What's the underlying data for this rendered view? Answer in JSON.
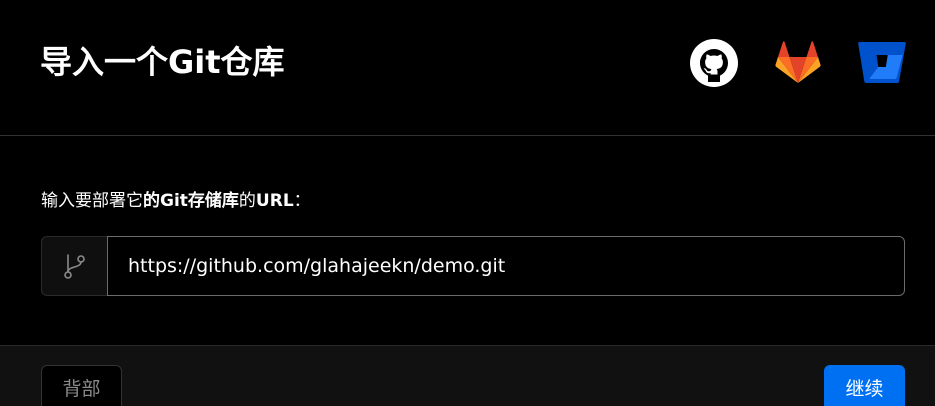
{
  "header": {
    "title": "导入一个Git仓库",
    "providers": [
      {
        "name": "GitHub",
        "icon": "github-icon",
        "color": "#ffffff"
      },
      {
        "name": "GitLab",
        "icon": "gitlab-icon",
        "color": "#fc6d26"
      },
      {
        "name": "Bitbucket",
        "icon": "bitbucket-icon",
        "color": "#0052cc"
      }
    ]
  },
  "form": {
    "prompt_prefix": "输入要部署它",
    "prompt_bold_1": "的Git存储库",
    "prompt_middle": "的",
    "prompt_bold_2": "URL",
    "prompt_suffix": "：",
    "url_prefix_icon": "git-branch-icon",
    "url_value": "https://github.com/glahajeekn/demo.git"
  },
  "footer": {
    "back_label": "背部",
    "continue_label": "继续",
    "accent_color": "#0070f3"
  }
}
